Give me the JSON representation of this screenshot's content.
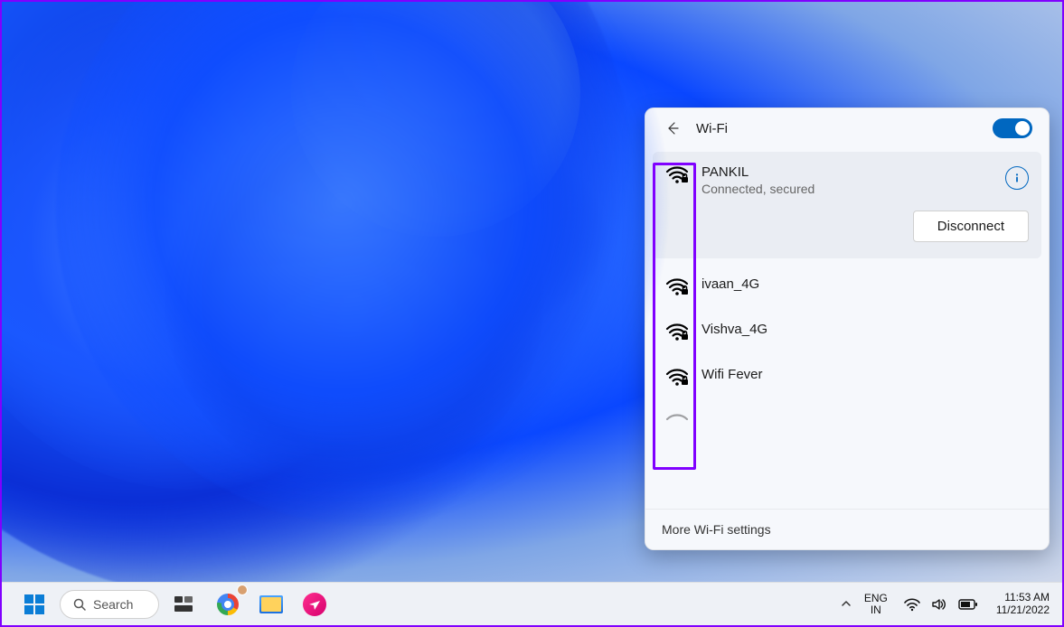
{
  "flyout": {
    "title": "Wi-Fi",
    "toggle_on": true,
    "footer_link": "More Wi-Fi settings",
    "connected": {
      "name": "PANKIL",
      "status": "Connected, secured",
      "disconnect_label": "Disconnect"
    },
    "networks": [
      {
        "name": "ivaan_4G"
      },
      {
        "name": "Vishva_4G"
      },
      {
        "name": "Wifi Fever"
      }
    ]
  },
  "taskbar": {
    "search_placeholder": "Search",
    "language_top": "ENG",
    "language_bottom": "IN",
    "time": "11:53 AM",
    "date": "11/21/2022"
  }
}
